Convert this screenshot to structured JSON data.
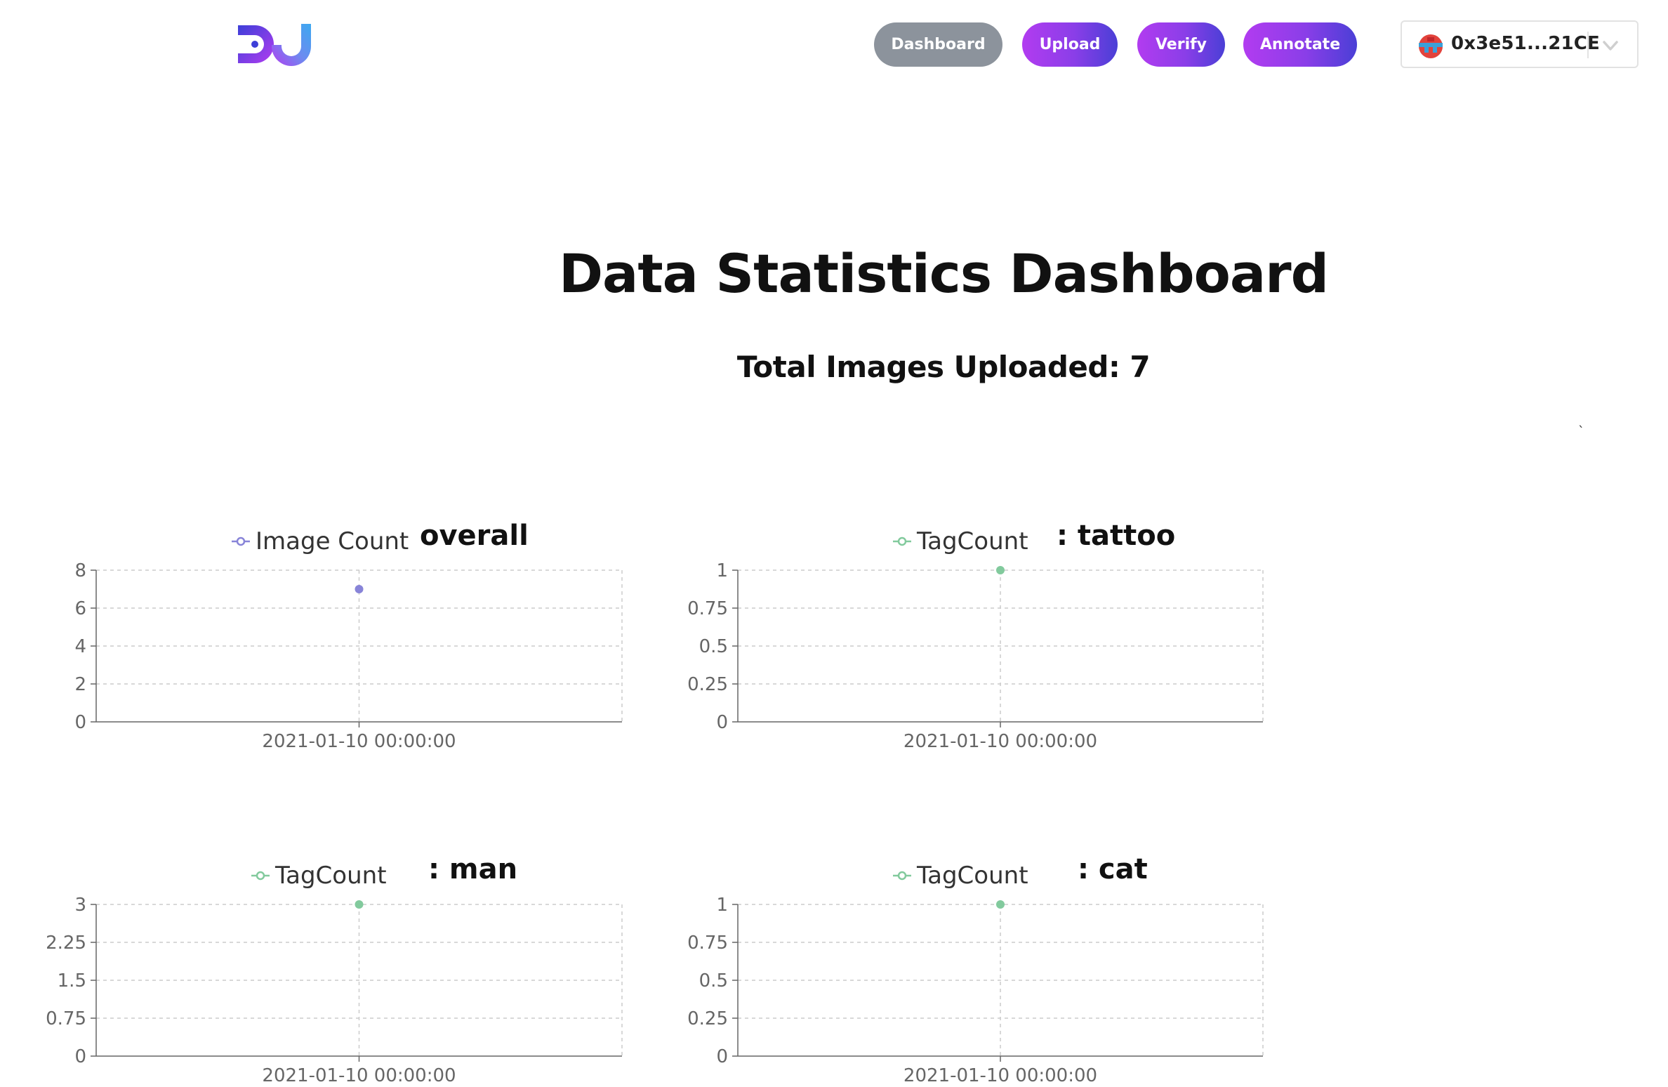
{
  "nav": {
    "logo_alt": "DJ",
    "dashboard_label": "Dashboard",
    "upload_label": "Upload",
    "verify_label": "Verify",
    "annotate_label": "Annotate",
    "active_tab": "Dashboard",
    "active_color": "#8c939c",
    "gradient_colors": [
      "#b23cf0",
      "#4a3fd6"
    ]
  },
  "wallet": {
    "address": "0x3e51...21CE",
    "avatar_icon": "identicon-avatar",
    "chevron_icon": "chevron-down-icon"
  },
  "page_title": "Data Statistics Dashboard",
  "total_images": "Total Images Uploaded: 7",
  "stray_mark": "`",
  "chart_data": [
    {
      "type": "line",
      "title": "overall",
      "legend": "Image Count",
      "series": [
        {
          "name": "Image Count",
          "color": "#8884d8",
          "x": [
            "2021-01-10 00:00:00"
          ],
          "values": [
            7
          ]
        }
      ],
      "y_ticks": [
        "0",
        "2",
        "4",
        "6",
        "8"
      ],
      "ylim": [
        0,
        8
      ],
      "grid": true
    },
    {
      "type": "line",
      "title": ": tattoo",
      "legend": "TagCount",
      "series": [
        {
          "name": "TagCount",
          "color": "#82ca9d",
          "x": [
            "2021-01-10 00:00:00"
          ],
          "values": [
            1
          ]
        }
      ],
      "y_ticks": [
        "0",
        "0.25",
        "0.5",
        "0.75",
        "1"
      ],
      "ylim": [
        0,
        1
      ],
      "grid": true
    },
    {
      "type": "line",
      "title": ": man",
      "legend": "TagCount",
      "series": [
        {
          "name": "TagCount",
          "color": "#82ca9d",
          "x": [
            "2021-01-10 00:00:00"
          ],
          "values": [
            3
          ]
        }
      ],
      "y_ticks": [
        "0",
        "0.75",
        "1.5",
        "2.25",
        "3"
      ],
      "ylim": [
        0,
        3
      ],
      "grid": true
    },
    {
      "type": "line",
      "title": ": cat",
      "legend": "TagCount",
      "series": [
        {
          "name": "TagCount",
          "color": "#82ca9d",
          "x": [
            "2021-01-10 00:00:00"
          ],
          "values": [
            1
          ]
        }
      ],
      "y_ticks": [
        "0",
        "0.25",
        "0.5",
        "0.75",
        "1"
      ],
      "ylim": [
        0,
        1
      ],
      "grid": true
    }
  ]
}
